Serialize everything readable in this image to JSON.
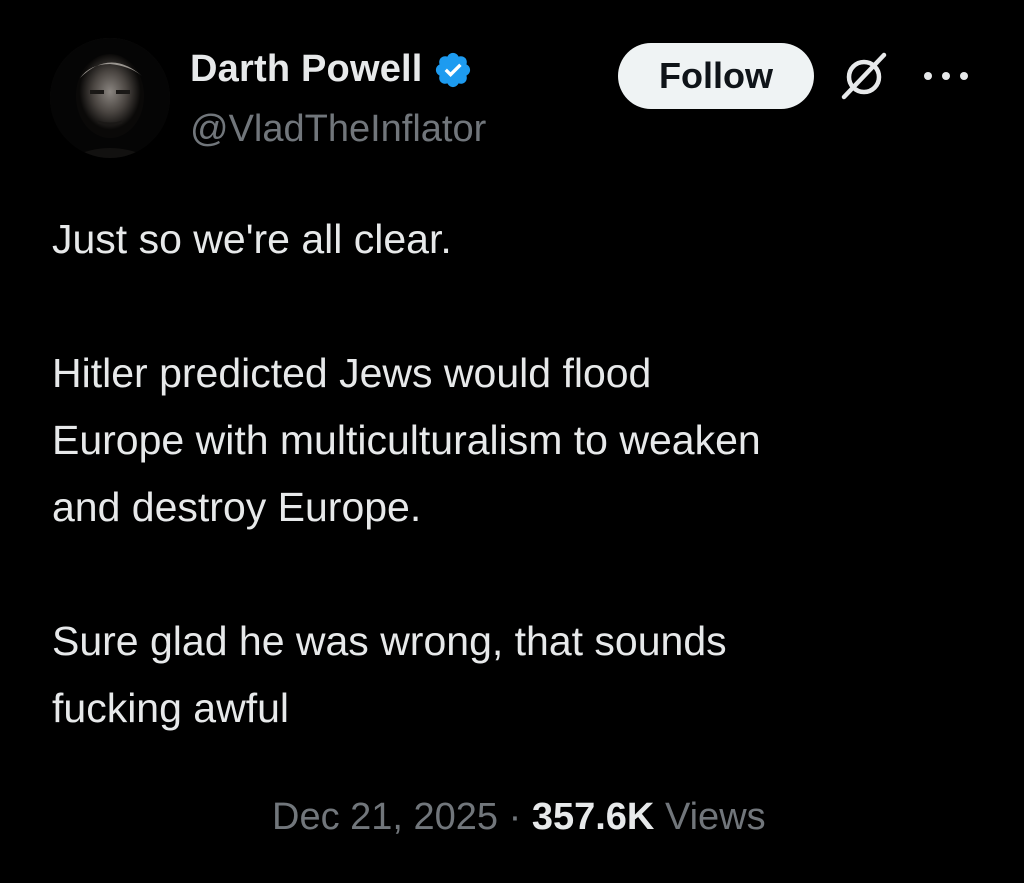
{
  "author": {
    "display_name": "Darth Powell",
    "handle": "@VladTheInflator",
    "verified": true,
    "verified_color": "#1d9bf0"
  },
  "actions": {
    "follow_label": "Follow",
    "grok_icon": "grok-icon",
    "more_icon": "more-icon"
  },
  "tweet": {
    "lines": [
      "Just so we're all clear.",
      "",
      "Hitler predicted Jews would flood",
      "Europe with multiculturalism to weaken",
      "and destroy Europe.",
      "",
      "Sure glad he was wrong, that sounds",
      "fucking awful"
    ]
  },
  "meta": {
    "date": "Dec 21, 2025",
    "separator": "·",
    "views_count": "357.6K",
    "views_label": "Views"
  },
  "colors": {
    "background": "#000000",
    "text_primary": "#e7e9ea",
    "text_secondary": "#71767b",
    "follow_bg": "#eff3f4"
  }
}
